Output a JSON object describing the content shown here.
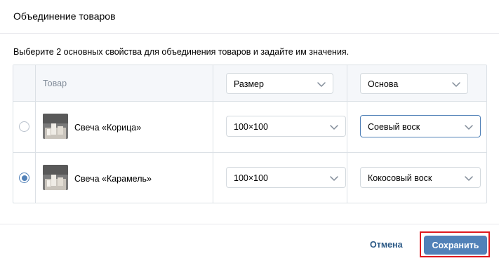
{
  "dialog": {
    "title": "Объединение товаров",
    "instruction": "Выберите 2 основных свойства для объединения товаров и задайте им значения."
  },
  "table": {
    "product_header": "Товар",
    "property_selects": [
      {
        "value": "Размер",
        "icon": "chevron-down-icon"
      },
      {
        "value": "Основа",
        "icon": "chevron-down-icon"
      }
    ],
    "rows": [
      {
        "name": "Свеча «Корица»",
        "selected": false,
        "size": "100×100",
        "base": "Соевый воск"
      },
      {
        "name": "Свеча «Карамель»",
        "selected": true,
        "size": "100×100",
        "base": "Кокосовый воск"
      }
    ]
  },
  "footer": {
    "cancel_label": "Отмена",
    "save_label": "Сохранить"
  },
  "colors": {
    "accent": "#5181b8",
    "link": "#2a5885",
    "highlight": "#e0191e",
    "header_bg": "#f5f7fa"
  }
}
